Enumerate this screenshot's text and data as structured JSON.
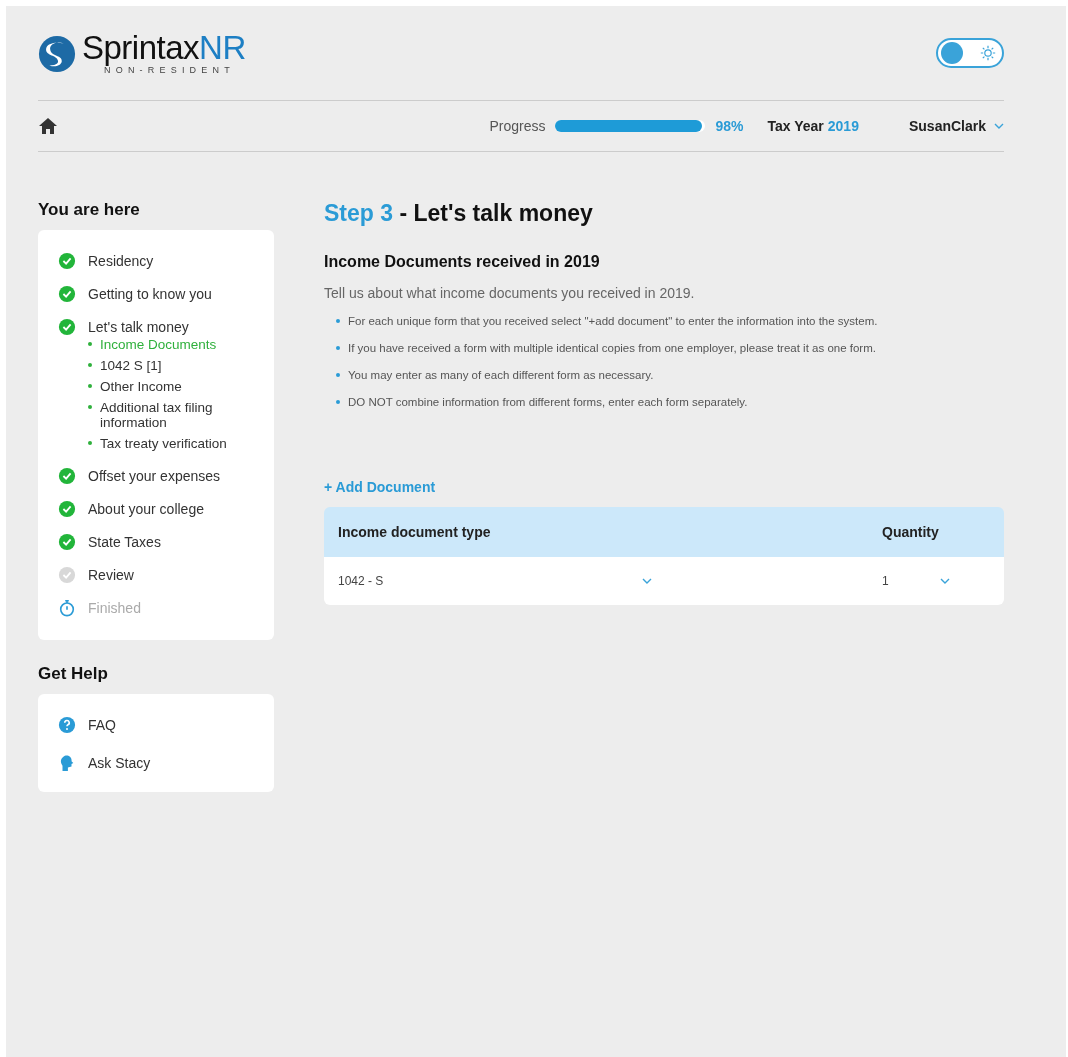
{
  "logo": {
    "name": "Sprintax",
    "suffix": "NR",
    "tagline": "NON-RESIDENT"
  },
  "theme_toggle": {
    "on": false
  },
  "nav": {
    "progress_label": "Progress",
    "progress": {
      "level": 0.98
    },
    "progress_reading": "98%",
    "tax_year_label": "Tax Year",
    "tax_year": "2019",
    "user": "SusanClark"
  },
  "sidebar": {
    "title": "You are here",
    "steps": [
      {
        "label": "Residency",
        "kind": "check",
        "completed": true
      },
      {
        "label": "Getting to know you",
        "kind": "check",
        "completed": true
      },
      {
        "label": "Let's talk money",
        "kind": "check",
        "completed": true,
        "children": [
          {
            "label": "Income Documents",
            "selected": true
          },
          {
            "label": "1042 S [1]",
            "selected": false
          },
          {
            "label": "Other Income",
            "selected": false
          },
          {
            "label": "Additional tax filing information",
            "selected": false
          },
          {
            "label": "Tax treaty verification",
            "selected": false
          }
        ]
      },
      {
        "label": "Offset your expenses",
        "kind": "check",
        "completed": true
      },
      {
        "label": "About your college",
        "kind": "check",
        "completed": true
      },
      {
        "label": "State Taxes",
        "kind": "check",
        "completed": true
      },
      {
        "label": "Review",
        "kind": "check",
        "completed": false
      },
      {
        "label": "Finished",
        "kind": "timer",
        "completed": false
      }
    ],
    "help_title": "Get Help",
    "help": [
      {
        "label": "FAQ",
        "kind": "faq"
      },
      {
        "label": "Ask Stacy",
        "kind": "assistant"
      }
    ]
  },
  "main": {
    "step": "Step 3",
    "title": "- Let's talk money",
    "heading": "Income Documents received in 2019",
    "intro": "Tell us about what income documents you received in 2019.",
    "bullets": [
      "For each unique form that you received select \"+add document\" to enter the information into the system.",
      "If you have received a form with multiple identical copies from one employer, please treat it as one form.",
      "You may enter as many of each different form as necessary.",
      "DO NOT combine information from different forms, enter each form separately."
    ],
    "add_link": "+ Add Document",
    "table": {
      "columns": [
        "Income document type",
        "Quantity"
      ],
      "rows": [
        {
          "type": "1042 - S",
          "quantity": "1"
        }
      ]
    }
  }
}
